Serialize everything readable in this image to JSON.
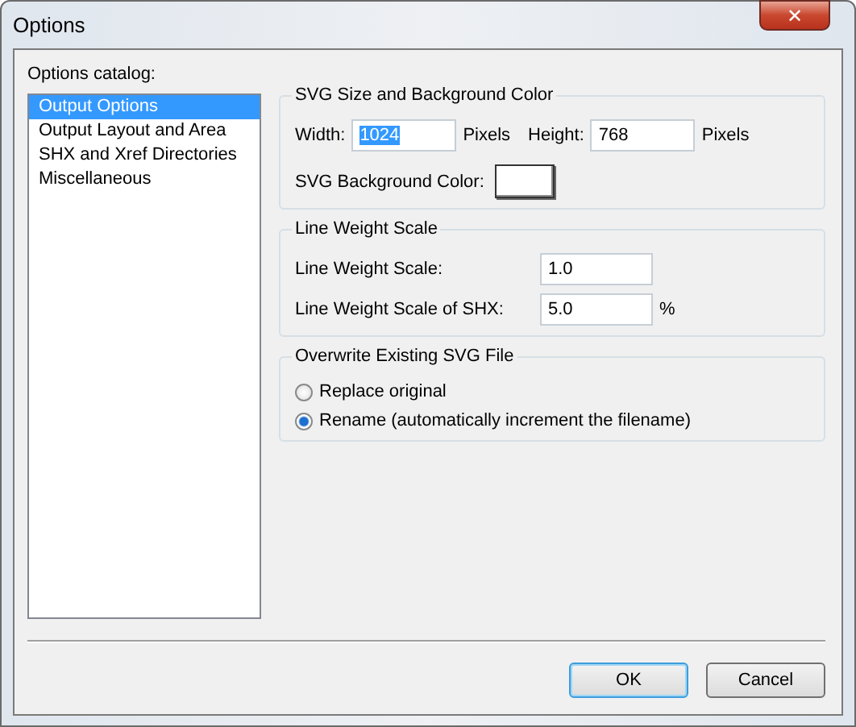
{
  "window": {
    "title": "Options",
    "close": "✕"
  },
  "catalog": {
    "label": "Options catalog:",
    "items": [
      {
        "label": "Output Options",
        "selected": true
      },
      {
        "label": "Output Layout and Area",
        "selected": false
      },
      {
        "label": "SHX and Xref Directories",
        "selected": false
      },
      {
        "label": "Miscellaneous",
        "selected": false
      }
    ]
  },
  "size_group": {
    "title": "SVG Size and Background Color",
    "width_label": "Width:",
    "width": {
      "value": "1024",
      "highlighted": true
    },
    "width_unit": "Pixels",
    "height_label": "Height:",
    "height": {
      "value": "768",
      "highlighted": false
    },
    "height_unit": "Pixels",
    "bg_label": "SVG Background Color:"
  },
  "weight_group": {
    "title": "Line Weight Scale",
    "rows": [
      {
        "label": "Line Weight Scale:",
        "value": "1.0"
      },
      {
        "label": "Line Weight Scale of SHX:",
        "value": "5.0",
        "unit": "%"
      }
    ]
  },
  "overwrite_group": {
    "title": "Overwrite Existing SVG File",
    "options": [
      {
        "label": "Replace original",
        "selected": false
      },
      {
        "label": "Rename (automatically increment the filename)",
        "selected": true
      }
    ]
  },
  "buttons": [
    {
      "label": "OK",
      "default": true
    },
    {
      "label": "Cancel",
      "default": false
    }
  ]
}
